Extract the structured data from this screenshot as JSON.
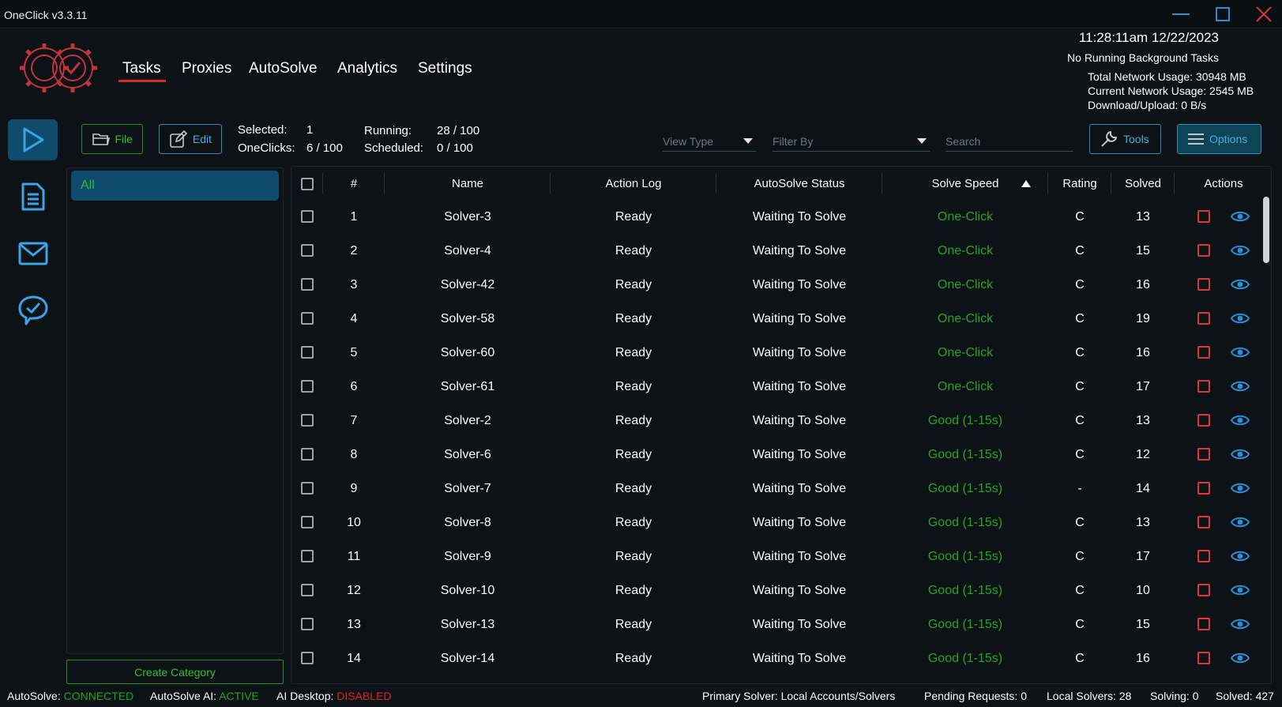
{
  "window": {
    "title": "OneClick v3.3.11"
  },
  "nav": [
    "Tasks",
    "Proxies",
    "AutoSolve",
    "Analytics",
    "Settings"
  ],
  "header": {
    "clock": "11:28:11am 12/22/2023",
    "background": "No Running Background Tasks",
    "total_network": "Total Network Usage:  30948 MB",
    "current_network": "Current Network Usage: 2545 MB",
    "download_upload": "Download/Upload: 0 B/s"
  },
  "toolbar": {
    "file_label": "File",
    "edit_label": "Edit",
    "selected_label": "Selected:",
    "selected_value": "1",
    "oneclicks_label": "OneClicks:",
    "oneclicks_value": "6 / 100",
    "running_label": "Running:",
    "running_value": "28 / 100",
    "scheduled_label": "Scheduled:",
    "scheduled_value": "0 / 100",
    "view_type": "View Type",
    "filter_by": "Filter By",
    "search_placeholder": "Search",
    "tools_label": "Tools",
    "options_label": "Options"
  },
  "categories": {
    "all_label": "All",
    "create_label": "Create Category"
  },
  "table": {
    "columns": [
      "#",
      "Name",
      "Action Log",
      "AutoSolve Status",
      "Solve Speed",
      "Rating",
      "Solved",
      "Actions"
    ],
    "rows": [
      {
        "num": "1",
        "name": "Solver-3",
        "log": "Ready",
        "status": "Waiting To Solve",
        "speed": "One-Click",
        "rating": "C",
        "solved": "13"
      },
      {
        "num": "2",
        "name": "Solver-4",
        "log": "Ready",
        "status": "Waiting To Solve",
        "speed": "One-Click",
        "rating": "C",
        "solved": "15"
      },
      {
        "num": "3",
        "name": "Solver-42",
        "log": "Ready",
        "status": "Waiting To Solve",
        "speed": "One-Click",
        "rating": "C",
        "solved": "16"
      },
      {
        "num": "4",
        "name": "Solver-58",
        "log": "Ready",
        "status": "Waiting To Solve",
        "speed": "One-Click",
        "rating": "C",
        "solved": "19"
      },
      {
        "num": "5",
        "name": "Solver-60",
        "log": "Ready",
        "status": "Waiting To Solve",
        "speed": "One-Click",
        "rating": "C",
        "solved": "16"
      },
      {
        "num": "6",
        "name": "Solver-61",
        "log": "Ready",
        "status": "Waiting To Solve",
        "speed": "One-Click",
        "rating": "C",
        "solved": "17"
      },
      {
        "num": "7",
        "name": "Solver-2",
        "log": "Ready",
        "status": "Waiting To Solve",
        "speed": "Good (1-15s)",
        "rating": "C",
        "solved": "13"
      },
      {
        "num": "8",
        "name": "Solver-6",
        "log": "Ready",
        "status": "Waiting To Solve",
        "speed": "Good (1-15s)",
        "rating": "C",
        "solved": "12"
      },
      {
        "num": "9",
        "name": "Solver-7",
        "log": "Ready",
        "status": "Waiting To Solve",
        "speed": "Good (1-15s)",
        "rating": "-",
        "solved": "14"
      },
      {
        "num": "10",
        "name": "Solver-8",
        "log": "Ready",
        "status": "Waiting To Solve",
        "speed": "Good (1-15s)",
        "rating": "C",
        "solved": "13"
      },
      {
        "num": "11",
        "name": "Solver-9",
        "log": "Ready",
        "status": "Waiting To Solve",
        "speed": "Good (1-15s)",
        "rating": "C",
        "solved": "17"
      },
      {
        "num": "12",
        "name": "Solver-10",
        "log": "Ready",
        "status": "Waiting To Solve",
        "speed": "Good (1-15s)",
        "rating": "C",
        "solved": "10"
      },
      {
        "num": "13",
        "name": "Solver-13",
        "log": "Ready",
        "status": "Waiting To Solve",
        "speed": "Good (1-15s)",
        "rating": "C",
        "solved": "15"
      },
      {
        "num": "14",
        "name": "Solver-14",
        "log": "Ready",
        "status": "Waiting To Solve",
        "speed": "Good (1-15s)",
        "rating": "C",
        "solved": "16"
      }
    ]
  },
  "status_bar": {
    "autosolve_label": "AutoSolve:",
    "autosolve_value": "CONNECTED",
    "ai_label": "AutoSolve AI:",
    "ai_value": "ACTIVE",
    "desktop_label": "AI Desktop:",
    "desktop_value": "DISABLED",
    "primary_solver": "Primary Solver: Local Accounts/Solvers",
    "pending": "Pending Requests: 0",
    "local_solvers": "Local Solvers: 28",
    "solving": "Solving: 0",
    "solved": "Solved: 427"
  },
  "colors": {
    "accent_blue": "#3fb0e0",
    "active_bg": "#0f4b6d",
    "success_green": "#26a626",
    "danger_red": "#d9363e"
  },
  "icons": [
    "gears-check-logo",
    "play-icon",
    "document-icon",
    "mail-icon",
    "chat-check-icon",
    "folder-icon",
    "edit-icon",
    "wrench-icon",
    "menu-icon",
    "eye-icon",
    "stop-icon",
    "sort-up-icon"
  ]
}
